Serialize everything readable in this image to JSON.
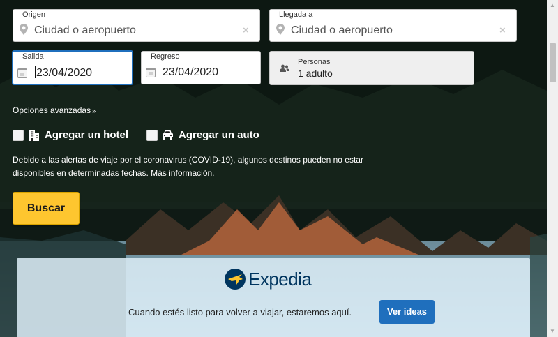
{
  "flight_form": {
    "origin": {
      "label": "Origen",
      "placeholder": "Ciudad o aeropuerto"
    },
    "destination": {
      "label": "Llegada a",
      "placeholder": "Ciudad o aeropuerto"
    },
    "departure": {
      "label": "Salida",
      "value": "23/04/2020"
    },
    "return": {
      "label": "Regreso",
      "value": "23/04/2020"
    },
    "travelers": {
      "label": "Personas",
      "value": "1 adulto"
    },
    "advanced_options": "Opciones avanzadas",
    "add_hotel": "Agregar un hotel",
    "add_car": "Agregar un auto",
    "notice_text": "Debido a las alertas de viaje por el coronavirus (COVID-19), algunos destinos pueden no estar disponibles en determinadas fechas.",
    "notice_link": "Más información.",
    "search_button": "Buscar"
  },
  "banner": {
    "brand": "Expedia",
    "message": "Cuando estés listo para volver a viajar, estaremos aquí.",
    "button": "Ver ideas"
  },
  "colors": {
    "accent_blue": "#1f6fbd",
    "search_yellow": "#fec62f",
    "brand_navy": "#00355f"
  },
  "icons": {
    "origin": "map-pin-icon",
    "destination": "map-pin-icon",
    "clear": "close-icon",
    "calendar": "calendar-icon",
    "travelers": "people-icon",
    "hotel": "building-icon",
    "car": "car-icon",
    "chevron": "double-chevron-down-icon",
    "logo": "expedia-globe-icon"
  }
}
